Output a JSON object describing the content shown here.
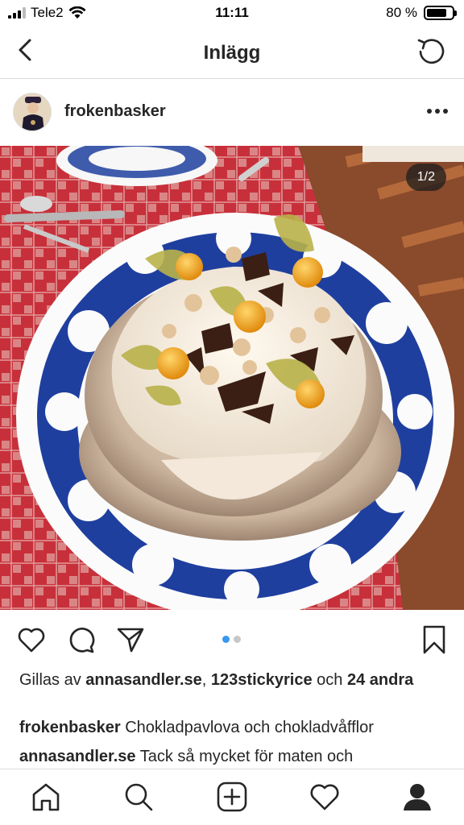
{
  "status_bar": {
    "carrier": "Tele2",
    "time": "11:11",
    "battery": "80 %",
    "battery_level": 0.8
  },
  "header": {
    "title": "Inlägg",
    "back_icon": "chevron-left-icon",
    "refresh_icon": "refresh-icon"
  },
  "post": {
    "username": "frokenbasker",
    "image_counter": "1/2",
    "carousel_total": 2,
    "carousel_active": 1,
    "likes": {
      "prefix": "Gillas av",
      "user1": "annasandler.se",
      "separator": ",",
      "user2": "123stickyrice",
      "conjunction": "och",
      "count": "24",
      "suffix": "andra"
    },
    "caption": {
      "user": "frokenbasker",
      "text": "Chokladpavlova och chokladvåfflor"
    },
    "comment": {
      "user": "annasandler.se",
      "text": "Tack så mycket för maten och"
    }
  },
  "action_icons": [
    "heart-icon",
    "comment-icon",
    "share-icon",
    "bookmark-icon"
  ],
  "tab_bar": [
    "home-icon",
    "search-icon",
    "add-icon",
    "activity-icon",
    "profile-icon"
  ],
  "colors": {
    "accent": "#3897f0",
    "text": "#262626",
    "divider": "#dbdbdb"
  }
}
